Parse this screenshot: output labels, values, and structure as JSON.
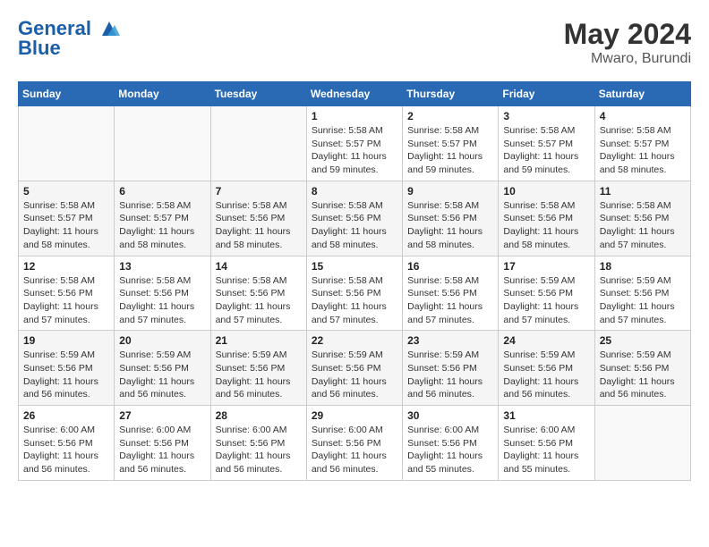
{
  "header": {
    "logo_line1": "General",
    "logo_line2": "Blue",
    "month_year": "May 2024",
    "location": "Mwaro, Burundi"
  },
  "weekdays": [
    "Sunday",
    "Monday",
    "Tuesday",
    "Wednesday",
    "Thursday",
    "Friday",
    "Saturday"
  ],
  "weeks": [
    [
      {
        "day": "",
        "sunrise": "",
        "sunset": "",
        "daylight": ""
      },
      {
        "day": "",
        "sunrise": "",
        "sunset": "",
        "daylight": ""
      },
      {
        "day": "",
        "sunrise": "",
        "sunset": "",
        "daylight": ""
      },
      {
        "day": "1",
        "sunrise": "Sunrise: 5:58 AM",
        "sunset": "Sunset: 5:57 PM",
        "daylight": "Daylight: 11 hours and 59 minutes."
      },
      {
        "day": "2",
        "sunrise": "Sunrise: 5:58 AM",
        "sunset": "Sunset: 5:57 PM",
        "daylight": "Daylight: 11 hours and 59 minutes."
      },
      {
        "day": "3",
        "sunrise": "Sunrise: 5:58 AM",
        "sunset": "Sunset: 5:57 PM",
        "daylight": "Daylight: 11 hours and 59 minutes."
      },
      {
        "day": "4",
        "sunrise": "Sunrise: 5:58 AM",
        "sunset": "Sunset: 5:57 PM",
        "daylight": "Daylight: 11 hours and 58 minutes."
      }
    ],
    [
      {
        "day": "5",
        "sunrise": "Sunrise: 5:58 AM",
        "sunset": "Sunset: 5:57 PM",
        "daylight": "Daylight: 11 hours and 58 minutes."
      },
      {
        "day": "6",
        "sunrise": "Sunrise: 5:58 AM",
        "sunset": "Sunset: 5:57 PM",
        "daylight": "Daylight: 11 hours and 58 minutes."
      },
      {
        "day": "7",
        "sunrise": "Sunrise: 5:58 AM",
        "sunset": "Sunset: 5:56 PM",
        "daylight": "Daylight: 11 hours and 58 minutes."
      },
      {
        "day": "8",
        "sunrise": "Sunrise: 5:58 AM",
        "sunset": "Sunset: 5:56 PM",
        "daylight": "Daylight: 11 hours and 58 minutes."
      },
      {
        "day": "9",
        "sunrise": "Sunrise: 5:58 AM",
        "sunset": "Sunset: 5:56 PM",
        "daylight": "Daylight: 11 hours and 58 minutes."
      },
      {
        "day": "10",
        "sunrise": "Sunrise: 5:58 AM",
        "sunset": "Sunset: 5:56 PM",
        "daylight": "Daylight: 11 hours and 58 minutes."
      },
      {
        "day": "11",
        "sunrise": "Sunrise: 5:58 AM",
        "sunset": "Sunset: 5:56 PM",
        "daylight": "Daylight: 11 hours and 57 minutes."
      }
    ],
    [
      {
        "day": "12",
        "sunrise": "Sunrise: 5:58 AM",
        "sunset": "Sunset: 5:56 PM",
        "daylight": "Daylight: 11 hours and 57 minutes."
      },
      {
        "day": "13",
        "sunrise": "Sunrise: 5:58 AM",
        "sunset": "Sunset: 5:56 PM",
        "daylight": "Daylight: 11 hours and 57 minutes."
      },
      {
        "day": "14",
        "sunrise": "Sunrise: 5:58 AM",
        "sunset": "Sunset: 5:56 PM",
        "daylight": "Daylight: 11 hours and 57 minutes."
      },
      {
        "day": "15",
        "sunrise": "Sunrise: 5:58 AM",
        "sunset": "Sunset: 5:56 PM",
        "daylight": "Daylight: 11 hours and 57 minutes."
      },
      {
        "day": "16",
        "sunrise": "Sunrise: 5:58 AM",
        "sunset": "Sunset: 5:56 PM",
        "daylight": "Daylight: 11 hours and 57 minutes."
      },
      {
        "day": "17",
        "sunrise": "Sunrise: 5:59 AM",
        "sunset": "Sunset: 5:56 PM",
        "daylight": "Daylight: 11 hours and 57 minutes."
      },
      {
        "day": "18",
        "sunrise": "Sunrise: 5:59 AM",
        "sunset": "Sunset: 5:56 PM",
        "daylight": "Daylight: 11 hours and 57 minutes."
      }
    ],
    [
      {
        "day": "19",
        "sunrise": "Sunrise: 5:59 AM",
        "sunset": "Sunset: 5:56 PM",
        "daylight": "Daylight: 11 hours and 56 minutes."
      },
      {
        "day": "20",
        "sunrise": "Sunrise: 5:59 AM",
        "sunset": "Sunset: 5:56 PM",
        "daylight": "Daylight: 11 hours and 56 minutes."
      },
      {
        "day": "21",
        "sunrise": "Sunrise: 5:59 AM",
        "sunset": "Sunset: 5:56 PM",
        "daylight": "Daylight: 11 hours and 56 minutes."
      },
      {
        "day": "22",
        "sunrise": "Sunrise: 5:59 AM",
        "sunset": "Sunset: 5:56 PM",
        "daylight": "Daylight: 11 hours and 56 minutes."
      },
      {
        "day": "23",
        "sunrise": "Sunrise: 5:59 AM",
        "sunset": "Sunset: 5:56 PM",
        "daylight": "Daylight: 11 hours and 56 minutes."
      },
      {
        "day": "24",
        "sunrise": "Sunrise: 5:59 AM",
        "sunset": "Sunset: 5:56 PM",
        "daylight": "Daylight: 11 hours and 56 minutes."
      },
      {
        "day": "25",
        "sunrise": "Sunrise: 5:59 AM",
        "sunset": "Sunset: 5:56 PM",
        "daylight": "Daylight: 11 hours and 56 minutes."
      }
    ],
    [
      {
        "day": "26",
        "sunrise": "Sunrise: 6:00 AM",
        "sunset": "Sunset: 5:56 PM",
        "daylight": "Daylight: 11 hours and 56 minutes."
      },
      {
        "day": "27",
        "sunrise": "Sunrise: 6:00 AM",
        "sunset": "Sunset: 5:56 PM",
        "daylight": "Daylight: 11 hours and 56 minutes."
      },
      {
        "day": "28",
        "sunrise": "Sunrise: 6:00 AM",
        "sunset": "Sunset: 5:56 PM",
        "daylight": "Daylight: 11 hours and 56 minutes."
      },
      {
        "day": "29",
        "sunrise": "Sunrise: 6:00 AM",
        "sunset": "Sunset: 5:56 PM",
        "daylight": "Daylight: 11 hours and 56 minutes."
      },
      {
        "day": "30",
        "sunrise": "Sunrise: 6:00 AM",
        "sunset": "Sunset: 5:56 PM",
        "daylight": "Daylight: 11 hours and 55 minutes."
      },
      {
        "day": "31",
        "sunrise": "Sunrise: 6:00 AM",
        "sunset": "Sunset: 5:56 PM",
        "daylight": "Daylight: 11 hours and 55 minutes."
      },
      {
        "day": "",
        "sunrise": "",
        "sunset": "",
        "daylight": ""
      }
    ]
  ]
}
